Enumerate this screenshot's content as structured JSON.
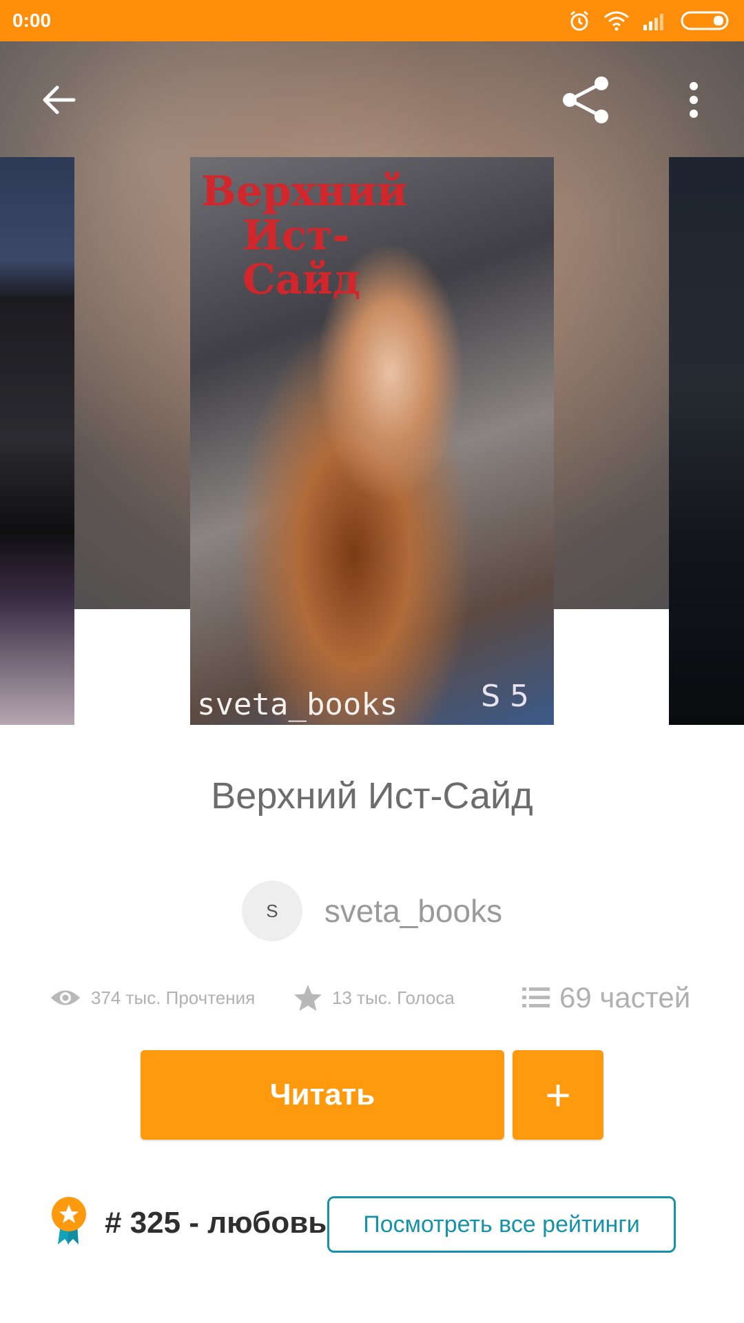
{
  "status_bar": {
    "time": "0:00"
  },
  "book": {
    "title": "Верхний Ист-Сайд",
    "cover_title_line1": "Верхний",
    "cover_title_line2": "Ист-Сайд",
    "cover_author": "sveta_books",
    "cover_badge": "S 5"
  },
  "author": {
    "avatar_letter": "S",
    "name": "sveta_books"
  },
  "stats": {
    "reads": "374 тыс. Прочтения",
    "votes": "13 тыс. Голоса",
    "parts": "69 частей"
  },
  "actions": {
    "read_label": "Читать",
    "add_label": "+"
  },
  "ranking": {
    "text": "# 325 - любовь",
    "view_all_label": "Посмотреть все рейтинги"
  },
  "colors": {
    "accent": "#ff9a0f",
    "status_bar": "#ff8f0a",
    "link": "#1692a8"
  },
  "icons": [
    "back-arrow-icon",
    "share-icon",
    "more-vertical-icon",
    "eye-icon",
    "star-icon",
    "list-icon",
    "ribbon-award-icon"
  ]
}
